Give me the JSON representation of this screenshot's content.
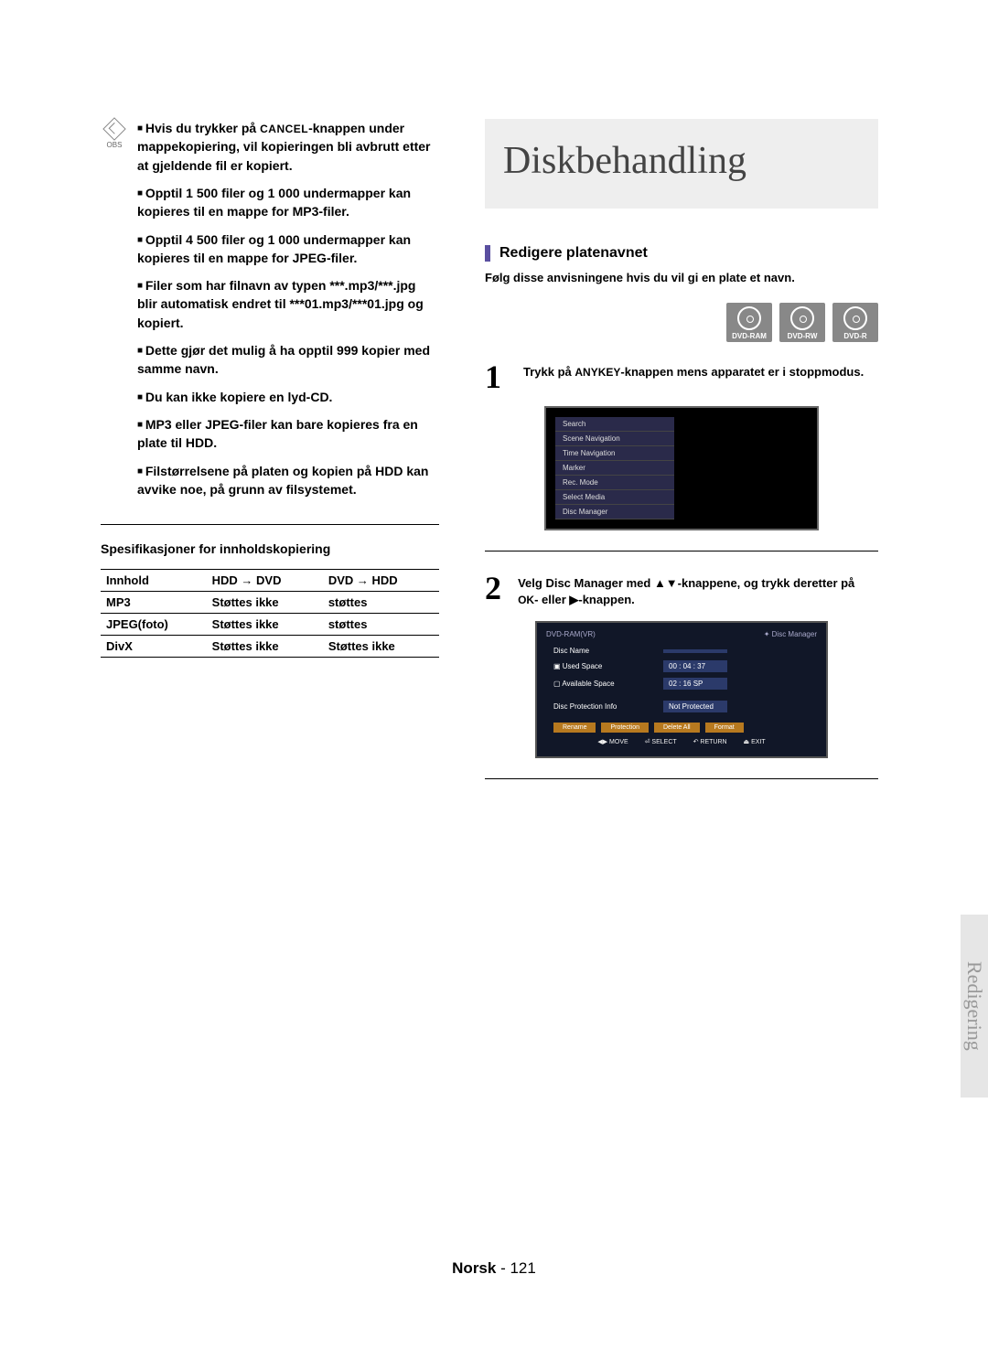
{
  "obs_label": "OBS",
  "notes": [
    {
      "pre": "Hvis du trykker på ",
      "btn": "CANCEL",
      "post": "-knappen under mappekopiering, vil kopieringen bli avbrutt etter at gjeldende fil er kopiert."
    },
    {
      "text": "Opptil 1 500 filer og 1 000 undermapper kan kopieres til en mappe for MP3-filer."
    },
    {
      "text": "Opptil 4 500 filer og 1 000 undermapper kan kopieres til en mappe for JPEG-filer."
    },
    {
      "text": "Filer som har filnavn av typen ***.mp3/***.jpg blir automatisk endret til ***01.mp3/***01.jpg og kopiert."
    },
    {
      "text": "Dette gjør det mulig å ha opptil 999 kopier med samme navn."
    },
    {
      "text": "Du kan ikke kopiere en lyd-CD."
    },
    {
      "text": "MP3 eller JPEG-filer kan bare kopieres fra en plate til HDD."
    },
    {
      "text": "Filstørrelsene på platen og kopien på HDD kan avvike noe, på grunn av filsystemet."
    }
  ],
  "spec_heading": "Spesifikasjoner for innholdskopiering",
  "spec_table": {
    "headers": [
      "Innhold",
      "HDD → DVD",
      "DVD → HDD"
    ],
    "rows": [
      [
        "MP3",
        "Støttes ikke",
        "støttes"
      ],
      [
        "JPEG(foto)",
        "Støttes ikke",
        "støttes"
      ],
      [
        "DivX",
        "Støttes ikke",
        "Støttes ikke"
      ]
    ]
  },
  "big_title": "Diskbehandling",
  "subheading": "Redigere platenavnet",
  "sub_intro": "Følg disse anvisningene hvis du vil gi en plate et navn.",
  "badges": [
    "DVD-RAM",
    "DVD-RW",
    "DVD-R"
  ],
  "step1": {
    "pre": "Trykk på ",
    "key": "ANYKEY",
    "post": "-knappen mens apparatet er i stoppmodus."
  },
  "osd_menu": [
    "Search",
    "Scene Navigation",
    "Time Navigation",
    "Marker",
    "Rec. Mode",
    "Select Media",
    "Disc Manager"
  ],
  "step2": {
    "pre": "Velg ",
    "bold1": "Disc Manager",
    "mid": " med ▲▼-knappene, og trykk deretter på ",
    "key": "OK",
    "mid2": "- eller ▶-knappen."
  },
  "osd2": {
    "header_left": "DVD-RAM(VR)",
    "header_right": "Disc Manager",
    "rows": [
      {
        "label": "Disc Name",
        "value": ""
      },
      {
        "label": "Used Space",
        "value": "00 : 04 : 37"
      },
      {
        "label": "Available Space",
        "value": "02 : 16 SP"
      },
      {
        "label": "Disc Protection Info",
        "value": "Not Protected"
      }
    ],
    "buttons": [
      "Rename",
      "Protection",
      "Delete All",
      "Format"
    ],
    "footer": [
      "◀▶ MOVE",
      "⏎ SELECT",
      "↶ RETURN",
      "⏏ EXIT"
    ]
  },
  "side_tab": "Redigering",
  "footer_lang": "Norsk",
  "footer_page": "- 121"
}
